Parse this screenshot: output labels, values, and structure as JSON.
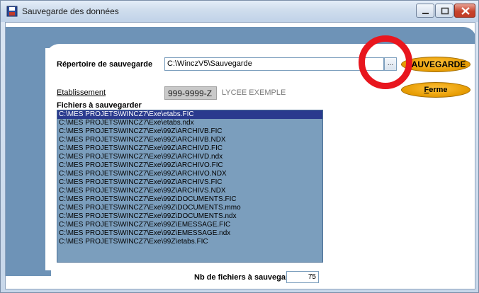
{
  "window": {
    "title": "Sauvegarde des données",
    "buttons": {
      "minimize": "minimize-icon",
      "maximize": "maximize-icon",
      "close": "close-icon"
    }
  },
  "form": {
    "repertoire_label": "Répertoire de sauvegarde",
    "repertoire_value": "C:\\WinczV5\\Sauvegarde",
    "browse_label": "...",
    "etablissement_label": "Etablissement",
    "etablissement_code": "999-9999-Z",
    "etablissement_name": "LYCEE EXEMPLE",
    "fichiers_label": "Fichiers à sauvegarder",
    "nb_fichiers_label": "Nb de fichiers à sauvegar",
    "nb_fichiers_value": "75"
  },
  "buttons": {
    "save_label": "SAUVEGARDE",
    "ferme_first": "F",
    "ferme_rest": "erme"
  },
  "files": [
    "C:\\MES PROJETS\\WINCZ7\\Exe\\etabs.FIC",
    "C:\\MES PROJETS\\WINCZ7\\Exe\\etabs.ndx",
    "C:\\MES PROJETS\\WINCZ7\\Exe\\99Z\\ARCHIVB.FIC",
    "C:\\MES PROJETS\\WINCZ7\\Exe\\99Z\\ARCHIVB.NDX",
    "C:\\MES PROJETS\\WINCZ7\\Exe\\99Z\\ARCHIVD.FIC",
    "C:\\MES PROJETS\\WINCZ7\\Exe\\99Z\\ARCHIVD.ndx",
    "C:\\MES PROJETS\\WINCZ7\\Exe\\99Z\\ARCHIVO.FIC",
    "C:\\MES PROJETS\\WINCZ7\\Exe\\99Z\\ARCHIVO.NDX",
    "C:\\MES PROJETS\\WINCZ7\\Exe\\99Z\\ARCHIVS.FIC",
    "C:\\MES PROJETS\\WINCZ7\\Exe\\99Z\\ARCHIVS.NDX",
    "C:\\MES PROJETS\\WINCZ7\\Exe\\99Z\\DOCUMENTS.FIC",
    "C:\\MES PROJETS\\WINCZ7\\Exe\\99Z\\DOCUMENTS.mmo",
    "C:\\MES PROJETS\\WINCZ7\\Exe\\99Z\\DOCUMENTS.ndx",
    "C:\\MES PROJETS\\WINCZ7\\Exe\\99Z\\EMESSAGE.FIC",
    "C:\\MES PROJETS\\WINCZ7\\Exe\\99Z\\EMESSAGE.ndx",
    "C:\\MES PROJETS\\WINCZ7\\Exe\\99Z\\etabs.FIC"
  ],
  "selected_index": 0,
  "colors": {
    "accent": "#6e93b7",
    "list_bg": "#7b9ebd",
    "selection": "#2a3a8e",
    "button": "#f2a900",
    "highlight_circle": "#e8161e"
  }
}
